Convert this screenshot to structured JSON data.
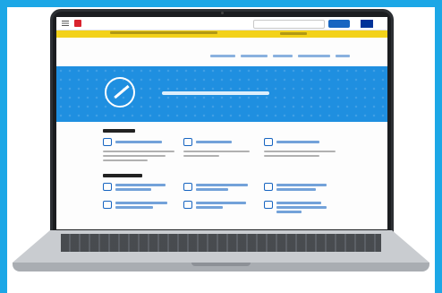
{
  "site": {
    "logo_text": "",
    "page_title": "",
    "hero_text": "",
    "section_1_title": "",
    "section_2_title": ""
  },
  "colors": {
    "frame": "#1ca7e6",
    "hero": "#1f8fe0",
    "notice_bar": "#f3d21a",
    "brand_red": "#d9232e",
    "link_blue": "#1765c1"
  },
  "icons": [
    "menu-icon",
    "gov-logo",
    "search-icon",
    "eu-flag-icon",
    "vaccine-icon"
  ]
}
